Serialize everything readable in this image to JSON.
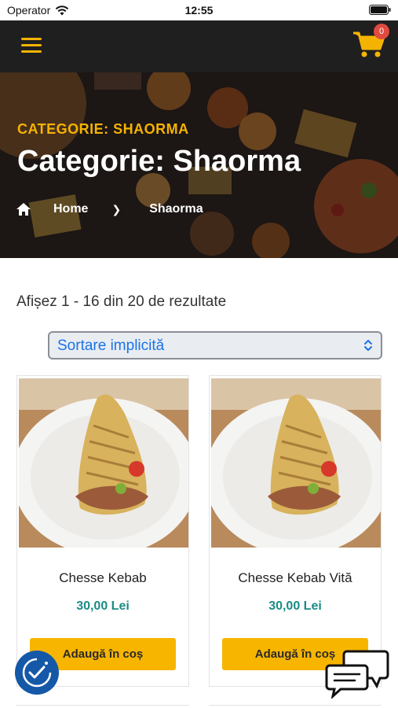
{
  "status_bar": {
    "carrier": "Operator",
    "time": "12:55"
  },
  "header": {
    "cart_count": "0"
  },
  "hero": {
    "kicker": "CATEGORIE: SHAORMA",
    "title": "Categorie: Shaorma",
    "breadcrumb": {
      "home": "Home",
      "current": "Shaorma"
    }
  },
  "results": {
    "count_text": "Afișez 1 - 16 din 20 de rezultate"
  },
  "sort": {
    "selected": "Sortare implicită"
  },
  "products": [
    {
      "name": "Chesse Kebab",
      "price": "30,00 Lei",
      "button": "Adaugă în coș"
    },
    {
      "name": "Chesse Kebab Vită",
      "price": "30,00 Lei",
      "button": "Adaugă în coș"
    }
  ],
  "colors": {
    "accent": "#f5b301",
    "price": "#1b8c86",
    "header_bg": "#1f1f1f",
    "badge": "#e04a3f",
    "link": "#1a73e8"
  }
}
